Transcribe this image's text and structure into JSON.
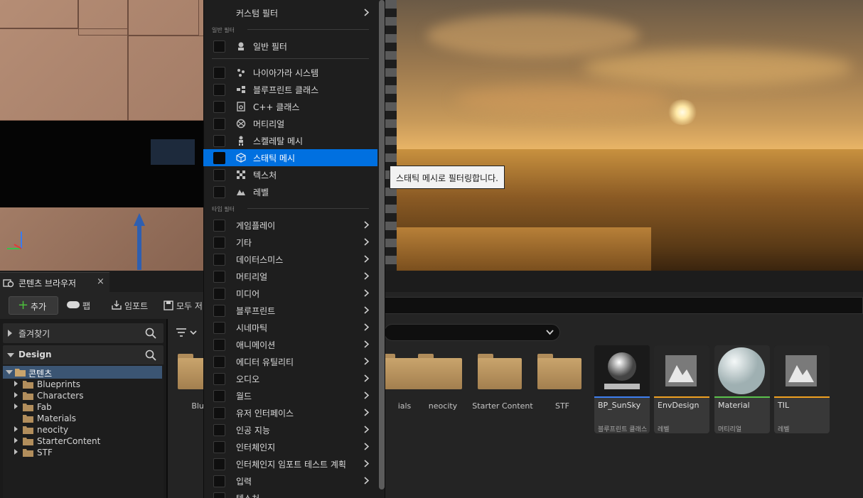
{
  "viewport": {
    "tooltip": "스태틱 메시로 필터링합니다."
  },
  "content_browser": {
    "tab_title": "콘텐츠 브라우저",
    "close_glyph": "×",
    "toolbar": {
      "add_label": "추가",
      "add_glyph": "+",
      "fab_label": "팹",
      "import_label": "임포트",
      "save_all_label": "모두 저"
    },
    "left": {
      "favorites_label": "즐겨찾기",
      "project_label": "Design",
      "root_label": "콘텐츠",
      "folders": [
        {
          "name": "Blueprints",
          "expandable": true
        },
        {
          "name": "Characters",
          "expandable": true
        },
        {
          "name": "Fab",
          "expandable": true
        },
        {
          "name": "Materials",
          "expandable": false
        },
        {
          "name": "neocity",
          "expandable": true
        },
        {
          "name": "StarterContent",
          "expandable": true
        },
        {
          "name": "STF",
          "expandable": true
        }
      ]
    },
    "grid": {
      "folders": [
        {
          "name": "Bluep"
        },
        {
          "name": "ials"
        },
        {
          "name": "neocity"
        },
        {
          "name": "Starter Content"
        },
        {
          "name": "STF"
        }
      ],
      "assets": [
        {
          "name": "BP_SunSky",
          "type": "블루프린트 클래스",
          "color": "#3d7ff0"
        },
        {
          "name": "EnvDesign",
          "type": "레벨",
          "color": "#f0a020"
        },
        {
          "name": "Material",
          "type": "머티리얼",
          "color": "#5ac24c"
        },
        {
          "name": "TIL",
          "type": "레벨",
          "color": "#f0a020"
        }
      ]
    }
  },
  "filter_menu": {
    "custom_filter": "커스텀 필터",
    "section_common": "일반 필터",
    "common_filter": "일반 필터",
    "items": [
      {
        "label": "나이아가라 시스템",
        "icon": "niagara-icon"
      },
      {
        "label": "블루프린트 클래스",
        "icon": "blueprint-class-icon"
      },
      {
        "label": "C++ 클래스",
        "icon": "cpp-class-icon"
      },
      {
        "label": "머티리얼",
        "icon": "material-icon"
      },
      {
        "label": "스켈레탈 메시",
        "icon": "skeletal-mesh-icon"
      },
      {
        "label": "스태틱 메시",
        "icon": "static-mesh-icon",
        "highlighted": true
      },
      {
        "label": "텍스처",
        "icon": "texture-icon"
      },
      {
        "label": "레벨",
        "icon": "level-icon"
      }
    ],
    "section_type": "타입 필터",
    "type_filters": [
      "게임플레이",
      "기타",
      "데이터스미스",
      "머티리얼",
      "미디어",
      "블루프린트",
      "시네마틱",
      "애니메이션",
      "에디터 유틸리티",
      "오디오",
      "월드",
      "유저 인터페이스",
      "인공 지능",
      "인터체인지",
      "인터체인지 임포트 테스트 계획",
      "입력",
      "텍스처"
    ],
    "accent_color": "#0070e0"
  }
}
